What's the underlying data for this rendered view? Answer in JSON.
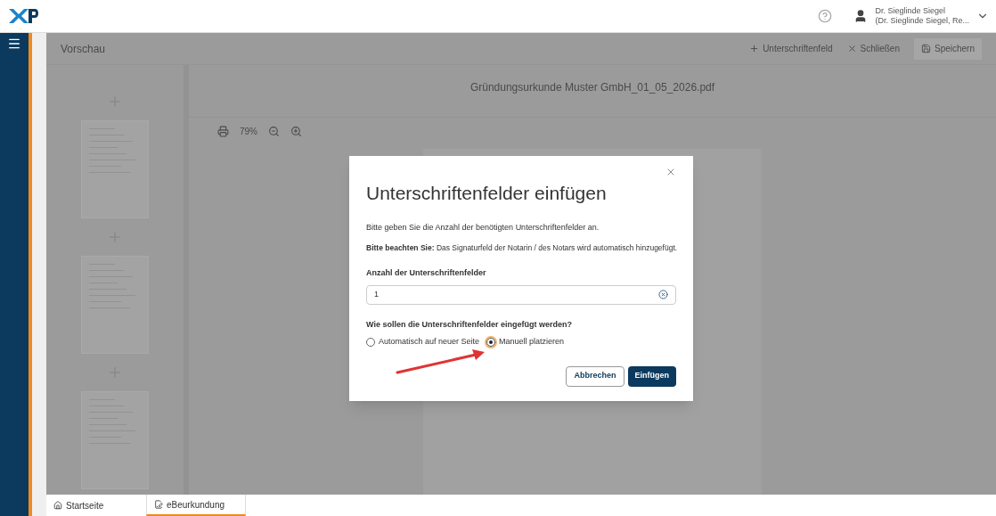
{
  "header": {
    "user_name": "Dr. Sieglinde Siegel",
    "user_detail": "(Dr. Sieglinde Siegel, Re..."
  },
  "background": {
    "title": "Vorschau",
    "actions": [
      {
        "label": "Unterschriftenfeld",
        "kind": "add"
      },
      {
        "label": "Schließen",
        "kind": "close"
      },
      {
        "label": "Speichern",
        "kind": "save"
      }
    ],
    "document_title": "Gründungsurkunde Muster GmbH_01_05_2026.pdf",
    "zoom": "79%"
  },
  "dialog": {
    "title": "Unterschriftenfelder einfügen",
    "intro": "Bitte geben Sie die Anzahl der benötigten Unterschriftenfelder an.",
    "note": "**Bitte beachten Sie:** Das Signaturfeld der Notarin / des Notars wird automatisch hinzugefügt.",
    "field_label": "Anzahl der Unterschriftenfelder",
    "field_value": "1",
    "question": "Wie sollen die Unterschriftenfelder eingefügt werden?",
    "options": [
      {
        "label": "Automatisch auf neuer Seite",
        "selected": false
      },
      {
        "label": "Manuell platzieren",
        "selected": true
      }
    ],
    "buttons": [
      {
        "label": "Abbrechen",
        "kind": "secondary"
      },
      {
        "label": "Einfügen",
        "kind": "primary"
      }
    ]
  },
  "bottom_tabs": [
    {
      "label": "Startseite",
      "kind": "home",
      "selected": false
    },
    {
      "label": "eBeurkundung",
      "kind": "doc",
      "selected": true
    }
  ]
}
